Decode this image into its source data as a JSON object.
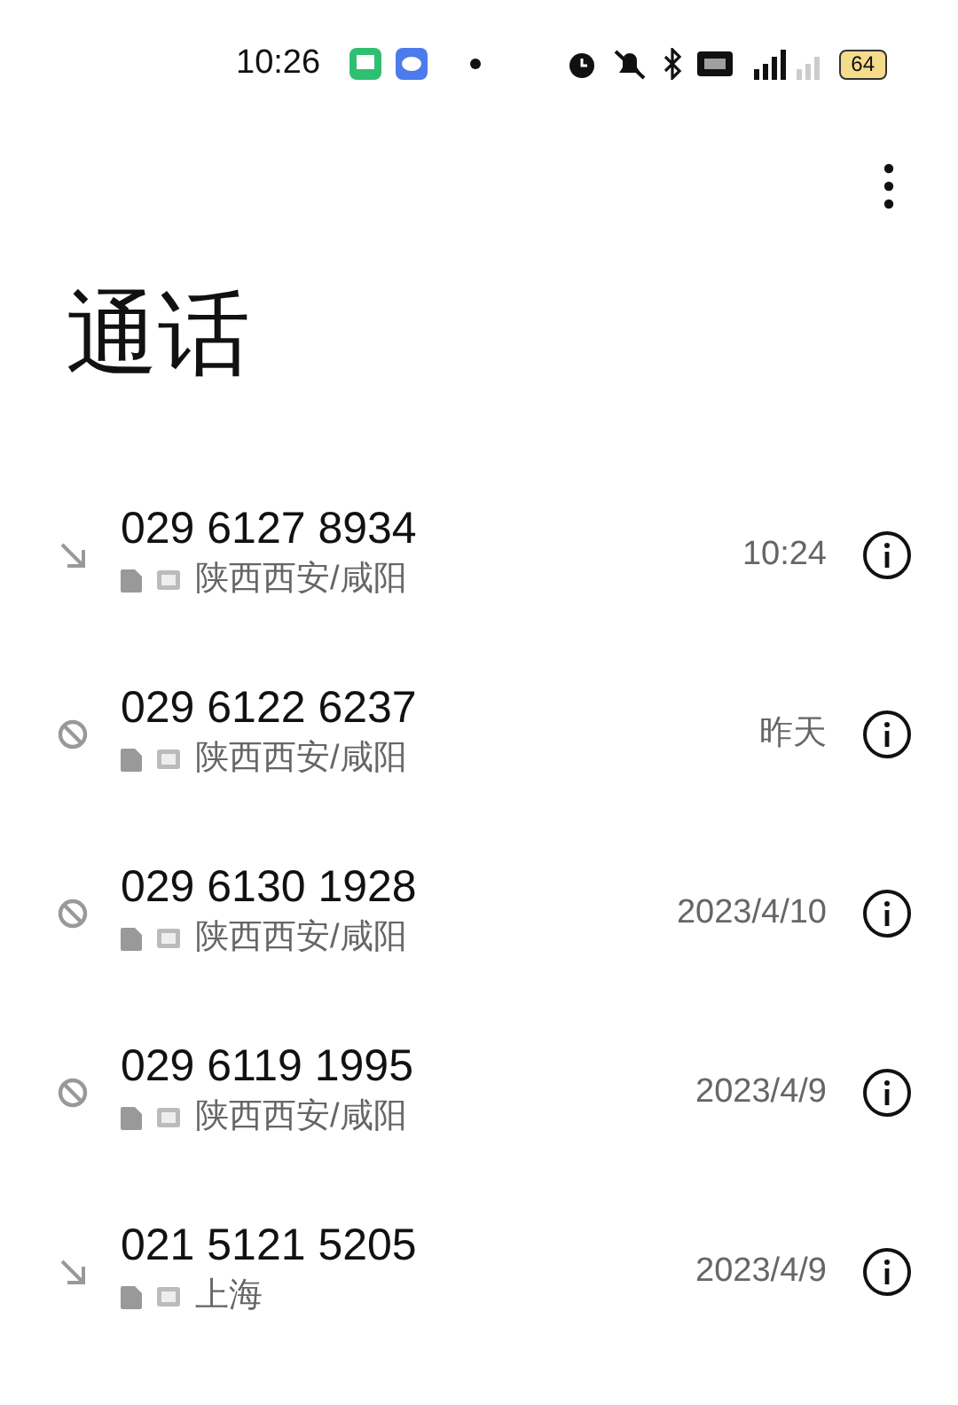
{
  "status_bar": {
    "time": "10:26",
    "battery": "64"
  },
  "title": "通话",
  "calls": [
    {
      "kind": "incoming",
      "number": "029 6127 8934",
      "location": "陕西西安/咸阳",
      "time": "10:24"
    },
    {
      "kind": "blocked",
      "number": "029 6122 6237",
      "location": "陕西西安/咸阳",
      "time": "昨天"
    },
    {
      "kind": "blocked",
      "number": "029 6130 1928",
      "location": "陕西西安/咸阳",
      "time": "2023/4/10"
    },
    {
      "kind": "blocked",
      "number": "029 6119 1995",
      "location": "陕西西安/咸阳",
      "time": "2023/4/9"
    },
    {
      "kind": "incoming",
      "number": "021 5121 5205",
      "location": "上海",
      "time": "2023/4/9"
    }
  ]
}
